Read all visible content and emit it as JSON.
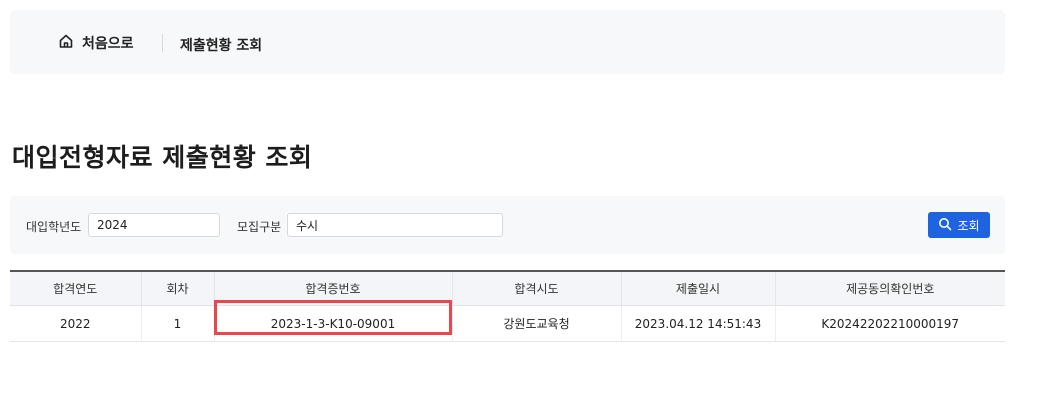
{
  "breadcrumb": {
    "home_label": "처음으로",
    "current_label": "제출현황 조회"
  },
  "page": {
    "title": "대입전형자료 제출현황 조회"
  },
  "search": {
    "year_label": "대입학년도",
    "year_value": "2024",
    "category_label": "모집구분",
    "category_value": "수시",
    "button_label": "조회",
    "button_color": "#1e63e0"
  },
  "table": {
    "headers": [
      "합격연도",
      "회차",
      "합격증번호",
      "합격시도",
      "제출일시",
      "제공동의확인번호"
    ],
    "rows": [
      [
        "2022",
        "1",
        "2023-1-3-K10-09001",
        "강원도교육청",
        "2023.04.12 14:51:43",
        "K20242202210000197"
      ]
    ]
  },
  "highlight": {
    "color": "#e8474c",
    "target": "합격증번호"
  }
}
